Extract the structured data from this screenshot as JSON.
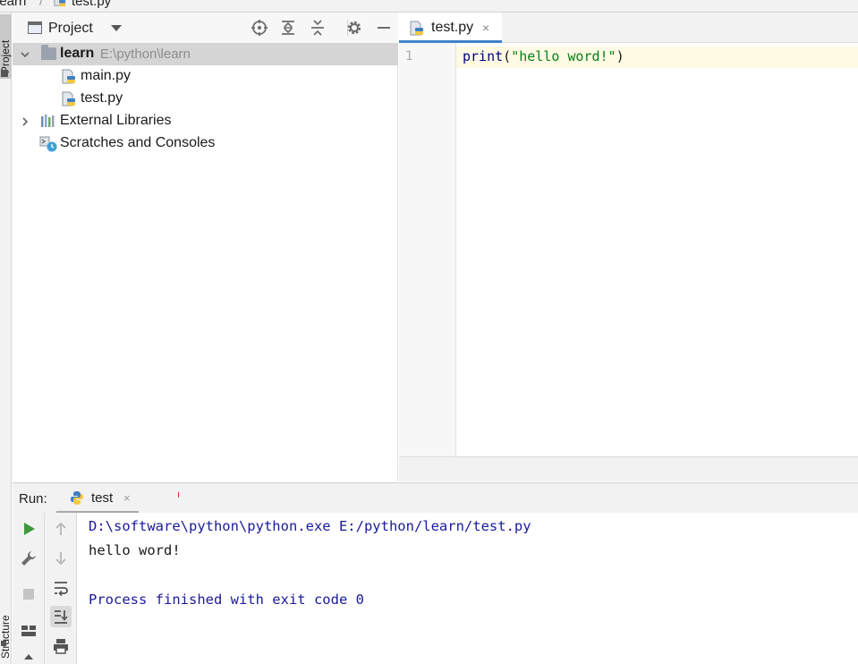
{
  "breadcrumb": {
    "project": "learn",
    "file": "test.py"
  },
  "side_tabs": {
    "project": "Project",
    "structure": "Structure"
  },
  "project_panel": {
    "title": "Project",
    "tree": [
      {
        "label": "learn",
        "path": "E:\\python\\learn",
        "type": "folder",
        "expanded": true
      },
      {
        "label": "main.py",
        "type": "python-file"
      },
      {
        "label": "test.py",
        "type": "python-file"
      },
      {
        "label": "External Libraries",
        "type": "libraries",
        "expanded": false
      },
      {
        "label": "Scratches and Consoles",
        "type": "scratches"
      }
    ]
  },
  "editor": {
    "tab_label": "test.py",
    "tab_close": "×",
    "line_number": "1",
    "code": {
      "fn": "print",
      "open": "(",
      "str": "\"hello word!\"",
      "close": ")"
    }
  },
  "run_panel": {
    "label": "Run:",
    "tab_label": "test",
    "tab_close": "×",
    "console": [
      "D:\\software\\python\\python.exe E:/python/learn/test.py",
      "hello word!",
      "",
      "Process finished with exit code 0"
    ]
  },
  "colors": {
    "accent": "#4083c9",
    "run_green": "#3c9a3c",
    "string_green": "#067d17",
    "keyword_navy": "#000080",
    "console_blue": "#1a1a9c"
  }
}
